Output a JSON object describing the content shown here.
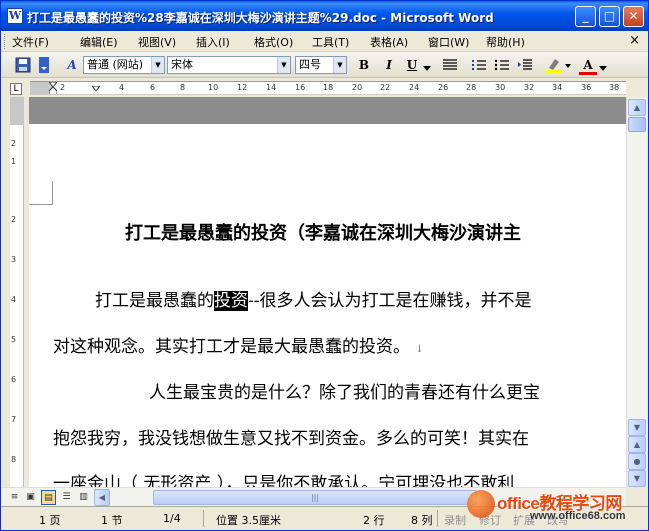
{
  "window": {
    "title": "打工是最愚蠢的投资%28李嘉诚在深圳大梅沙演讲主题%29.doc - Microsoft Word",
    "app_icon": "W",
    "controls": {
      "minimize": "_",
      "maximize": "□",
      "close": "✕"
    }
  },
  "menu": {
    "items": [
      "文件(F)",
      "编辑(E)",
      "视图(V)",
      "插入(I)",
      "格式(O)",
      "工具(T)",
      "表格(A)",
      "窗口(W)",
      "帮助(H)"
    ],
    "close_doc": "×"
  },
  "toolbar": {
    "style_value": "普通 (网站)",
    "font_value": "宋体",
    "size_value": "四号",
    "bold": "B",
    "italic": "I",
    "underline": "U",
    "style_icon_text": "A",
    "font_color_icon_text": "A"
  },
  "ruler": {
    "corner": "L",
    "ticks": [
      "2",
      "4",
      "6",
      "8",
      "10",
      "12",
      "14",
      "16",
      "18",
      "20",
      "22",
      "24",
      "26",
      "28",
      "30",
      "32",
      "34",
      "36",
      "38"
    ],
    "vticks": [
      "2",
      "1",
      "2",
      "3",
      "4",
      "5",
      "6",
      "7",
      "8"
    ]
  },
  "document": {
    "heading": "打工是最愚蠢的投资（李嘉诚在深圳大梅沙演讲主",
    "p1_before": "打工是最愚蠢的",
    "p1_selected": "投资",
    "p1_after": "--很多人会认为打工是在赚钱，并不是",
    "p2": "对这种观念。其实打工才是最大最愚蠢的投资。",
    "p2_mark": "↓",
    "p3": "人生最宝贵的是什么？除了我们的青春还有什么更宝",
    "p4": "抱怨我穷，我没钱想做生意又找不到资金。多么的可笑！其实在",
    "p5": "一座金山（ 无形资产 ），只是你不敢承认。宁可埋没也不敢利"
  },
  "statusbar": {
    "page": "1 页",
    "section": "1 节",
    "page_of": "1/4",
    "position": "位置 3.5厘米",
    "line": "2 行",
    "column": "8 列",
    "rec": "录制",
    "trk": "修订",
    "ext": "扩展",
    "ovr": "改写"
  },
  "watermark": {
    "main": "office教程学习网",
    "sub": "www.office68.com"
  }
}
